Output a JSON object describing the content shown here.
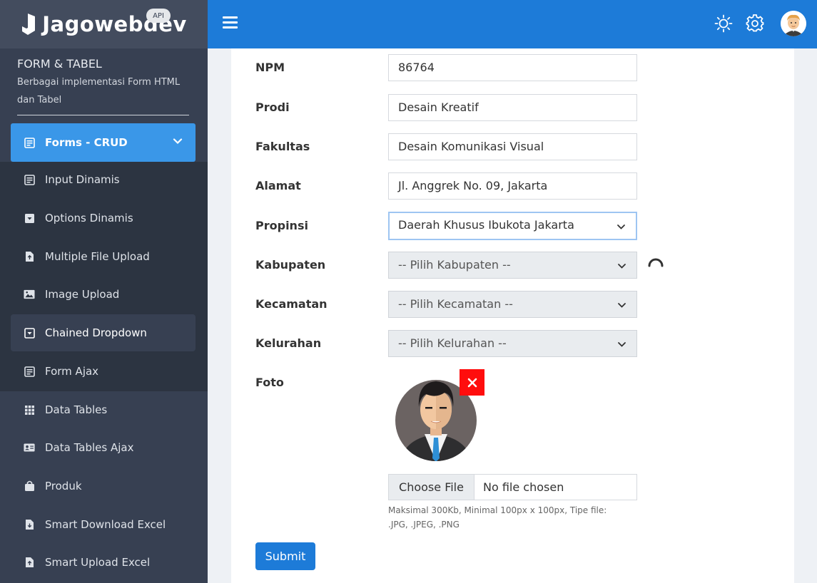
{
  "brand": {
    "name": "Jagowebdev",
    "badge": "API"
  },
  "sidebar": {
    "section_title": "FORM & TABEL",
    "section_desc": "Berbagai implementasi Form HTML dan Tabel",
    "active_menu": "Forms - CRUD",
    "sub_items": [
      {
        "label": "Input Dinamis",
        "icon": "form-icon"
      },
      {
        "label": "Options Dinamis",
        "icon": "dropdown-icon"
      },
      {
        "label": "Multiple File Upload",
        "icon": "file-upload-icon"
      },
      {
        "label": "Image Upload",
        "icon": "image-icon"
      },
      {
        "label": "Chained Dropdown",
        "icon": "dropdown-icon"
      },
      {
        "label": "Form Ajax",
        "icon": "form-icon"
      }
    ],
    "items": [
      {
        "label": "Data Tables",
        "icon": "table-icon"
      },
      {
        "label": "Data Tables Ajax",
        "icon": "id-card-icon"
      },
      {
        "label": "Produk",
        "icon": "bag-icon"
      },
      {
        "label": "Smart Download Excel",
        "icon": "download-file-icon"
      },
      {
        "label": "Smart Upload Excel",
        "icon": "upload-file-icon"
      }
    ]
  },
  "form": {
    "npm": {
      "label": "NPM",
      "value": "86764"
    },
    "prodi": {
      "label": "Prodi",
      "value": "Desain Kreatif"
    },
    "fakultas": {
      "label": "Fakultas",
      "value": "Desain Komunikasi Visual"
    },
    "alamat": {
      "label": "Alamat",
      "value": "Jl. Anggrek No. 09, Jakarta"
    },
    "propinsi": {
      "label": "Propinsi",
      "value": "Daerah Khusus Ibukota Jakarta"
    },
    "kabupaten": {
      "label": "Kabupaten",
      "value": "-- Pilih Kabupaten --"
    },
    "kecamatan": {
      "label": "Kecamatan",
      "value": "-- Pilih Kecamatan --"
    },
    "kelurahan": {
      "label": "Kelurahan",
      "value": "-- Pilih Kelurahan --"
    },
    "foto": {
      "label": "Foto",
      "choose_label": "Choose File",
      "file_name": "No file chosen",
      "hint": "Maksimal 300Kb, Minimal 100px x 100px, Tipe file: .JPG, .JPEG, .PNG"
    },
    "submit_label": "Submit"
  },
  "colors": {
    "topbar": "#1d7bd8",
    "sidebar": "#374052",
    "active": "#3a97e8",
    "remove": "#ff0d0d"
  }
}
